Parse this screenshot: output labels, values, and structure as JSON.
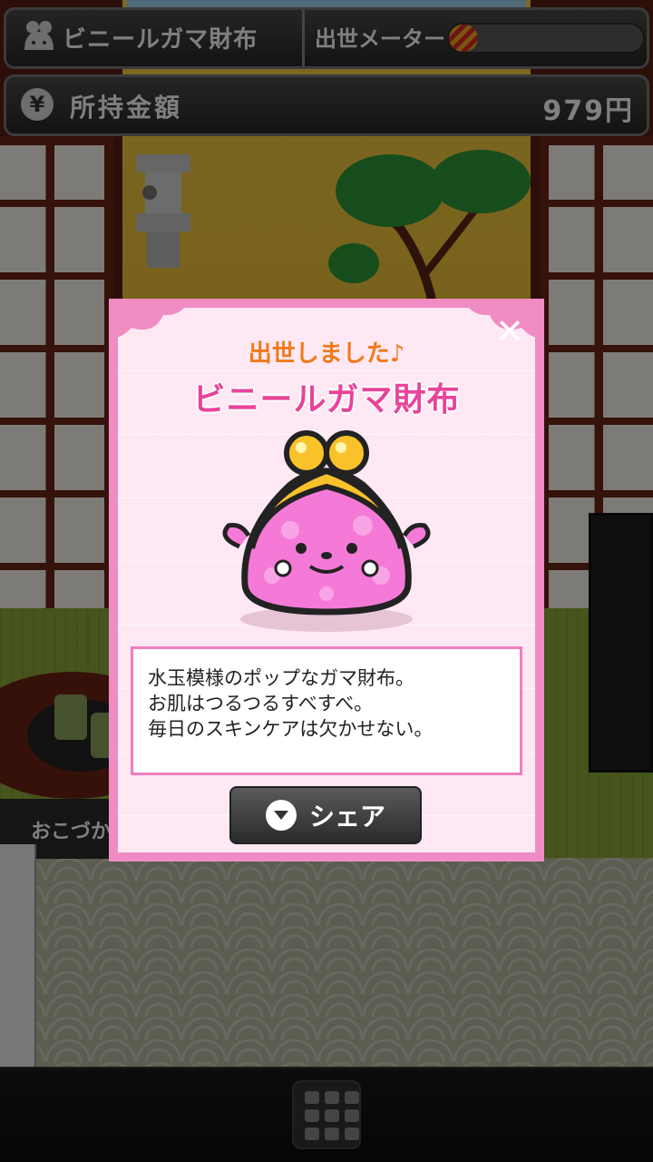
{
  "hud": {
    "wallet_name": "ビニールガマ財布",
    "meter_label": "出世メーター",
    "meter_progress": 0.15,
    "money_label": "所持金額",
    "money_value": "979円",
    "yen_symbol": "¥"
  },
  "background": {
    "okozukai_label": "おこづか"
  },
  "dialog": {
    "promoted_text": "出世しました♪",
    "wallet_title": "ビニールガマ財布",
    "description_lines": [
      "水玉模様のポップなガマ財布。",
      "お肌はつるつるすべすべ。",
      "毎日のスキンケアは欠かせない。"
    ],
    "share_label": "シェア",
    "close_symbol": "✕"
  },
  "colors": {
    "dialog_border": "#f08cc4",
    "title_pink": "#e8449a",
    "promoted_orange": "#f07a1a"
  },
  "icons": [
    "frog-wallet-icon",
    "yen-icon",
    "close-icon",
    "share-icon",
    "menu-grid-icon"
  ]
}
